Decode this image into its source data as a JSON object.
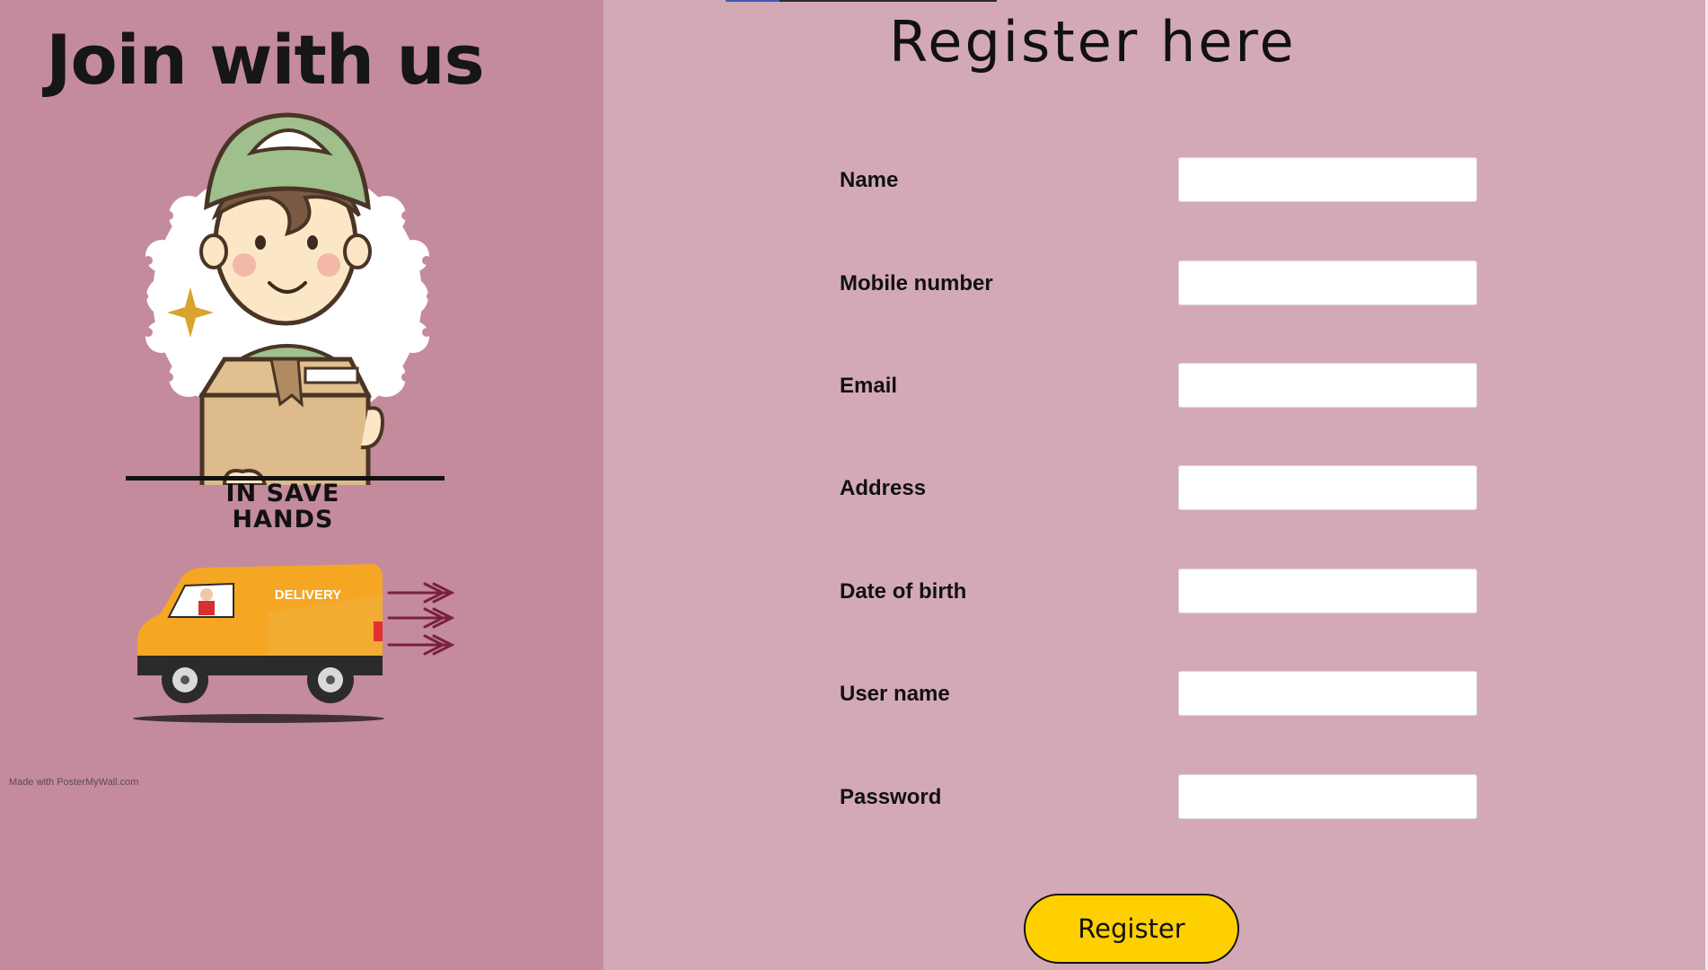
{
  "poster": {
    "title": "Join with us",
    "tagline_line1": "IN SAVE",
    "tagline_line2": "HANDS",
    "van_label": "DELIVERY",
    "watermark": "Made with PosterMyWall.com"
  },
  "form": {
    "title": "Register here",
    "fields": [
      {
        "label": "Name",
        "value": ""
      },
      {
        "label": "Mobile number",
        "value": ""
      },
      {
        "label": "Email",
        "value": ""
      },
      {
        "label": "Address",
        "value": ""
      },
      {
        "label": "Date of birth",
        "value": ""
      },
      {
        "label": "User name",
        "value": ""
      },
      {
        "label": "Password",
        "value": ""
      }
    ],
    "submit_label": "Register"
  },
  "colors": {
    "page_background": "#d4a9b6",
    "poster_background": "#c48b9c",
    "button_background": "#ffd000",
    "van_color": "#f5a623",
    "arrow_color": "#7a2040"
  },
  "icons": [
    "courier-illustration",
    "delivery-van-illustration",
    "speed-arrows-icon",
    "sparkle-icon"
  ]
}
